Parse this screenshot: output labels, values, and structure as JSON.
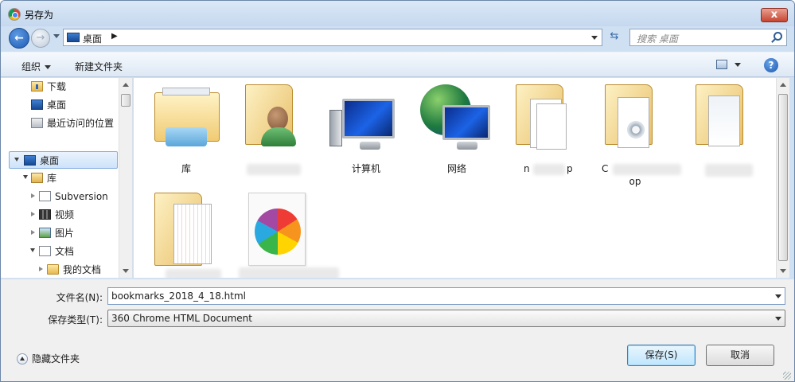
{
  "window": {
    "title": "另存为"
  },
  "address": {
    "path": "桌面",
    "chevron": "▶"
  },
  "search": {
    "placeholder": "搜索 桌面"
  },
  "toolbar": {
    "organize_label": "组织",
    "new_folder_label": "新建文件夹",
    "help_label": "?"
  },
  "nav": {
    "back": "←",
    "forward": "→",
    "refresh": "⇆"
  },
  "tree": {
    "items": [
      {
        "label": "下载",
        "icon": "download-folder-icon"
      },
      {
        "label": "桌面",
        "icon": "desktop-icon"
      },
      {
        "label": "最近访问的位置",
        "icon": "recent-places-icon"
      },
      {
        "label": "桌面",
        "icon": "desktop-icon",
        "selected": true
      },
      {
        "label": "库",
        "icon": "library-icon"
      },
      {
        "label": "Subversion",
        "icon": "document-library-icon"
      },
      {
        "label": "视频",
        "icon": "video-icon"
      },
      {
        "label": "图片",
        "icon": "pictures-icon"
      },
      {
        "label": "文档",
        "icon": "documents-icon"
      },
      {
        "label": "我的文档",
        "icon": "folder-icon"
      }
    ]
  },
  "files": [
    {
      "label": "库",
      "icon": "library-folder-icon"
    },
    {
      "label": "",
      "icon": "user-folder-icon"
    },
    {
      "label": "计算机",
      "icon": "computer-icon"
    },
    {
      "label": "网络",
      "icon": "network-icon"
    },
    {
      "label_left": "n",
      "label_right": "p",
      "icon": "folder-icon"
    },
    {
      "label_left": "C",
      "label_line2": "op",
      "icon": "folder-icon"
    },
    {
      "label": "",
      "icon": "folder-icon"
    },
    {
      "label": "",
      "icon": "folder-icon"
    },
    {
      "label": "",
      "icon": "pinwheel-app-icon"
    }
  ],
  "form": {
    "filename_label": "文件名(N):",
    "filename_value": "bookmarks_2018_4_18.html",
    "filetype_label": "保存类型(T):",
    "filetype_value": "360 Chrome HTML Document"
  },
  "footer": {
    "hide_folders_label": "隐藏文件夹",
    "save_label": "保存(S)",
    "cancel_label": "取消"
  },
  "controls": {
    "close_label": "x"
  }
}
